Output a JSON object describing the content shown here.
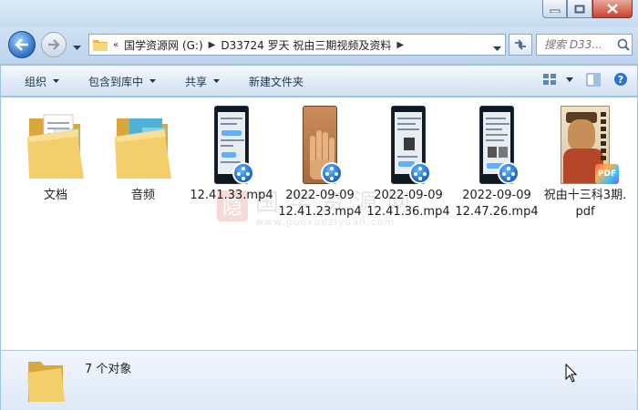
{
  "nav": {
    "breadcrumb": [
      "国学资源网 (G:)",
      "D33724 罗天 祝由三期视频及资料"
    ],
    "overflow_label": "«",
    "search_placeholder": "搜索 D33..."
  },
  "toolbar": {
    "commands": [
      {
        "label": "组织",
        "has_menu": true
      },
      {
        "label": "包含到库中",
        "has_menu": true
      },
      {
        "label": "共享",
        "has_menu": true
      },
      {
        "label": "新建文件夹",
        "has_menu": false
      }
    ]
  },
  "files": [
    {
      "name_line1": "文档",
      "name_line2": "",
      "type": "folder"
    },
    {
      "name_line1": "音频",
      "name_line2": "",
      "type": "folder"
    },
    {
      "name_line1": "12.41.33.mp4",
      "name_line2": "",
      "type": "video"
    },
    {
      "name_line1": "2022-09-09",
      "name_line2": "12.41.23.mp4",
      "type": "video"
    },
    {
      "name_line1": "2022-09-09",
      "name_line2": "12.41.36.mp4",
      "type": "video"
    },
    {
      "name_line1": "2022-09-09",
      "name_line2": "12.47.26.mp4",
      "type": "video"
    },
    {
      "name_line1": "祝由十三科3期.",
      "name_line2": "pdf",
      "type": "pdf"
    }
  ],
  "watermark": {
    "text": "国学资源网",
    "url": "www.guoxueziyuan.com"
  },
  "pdf_badge": "PDF",
  "status": {
    "item_count": "7 个对象"
  }
}
